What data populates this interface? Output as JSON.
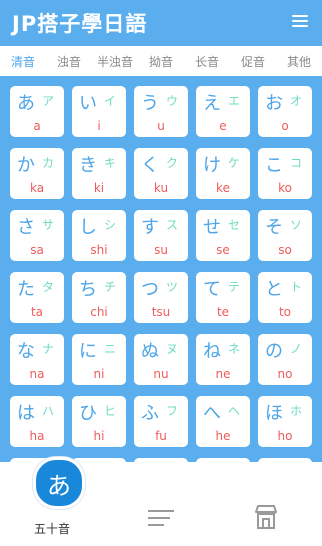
{
  "header": {
    "title": "JP搭子學日語",
    "menu_icon": "hamburger-menu-icon"
  },
  "tabs": [
    {
      "label": "清音",
      "active": true
    },
    {
      "label": "浊音",
      "active": false
    },
    {
      "label": "半浊音",
      "active": false
    },
    {
      "label": "拗音",
      "active": false
    },
    {
      "label": "长音",
      "active": false
    },
    {
      "label": "促音",
      "active": false
    },
    {
      "label": "其他",
      "active": false
    }
  ],
  "kana": [
    [
      {
        "hira": "あ",
        "kata": "ア",
        "roma": "a"
      },
      {
        "hira": "い",
        "kata": "イ",
        "roma": "i"
      },
      {
        "hira": "う",
        "kata": "ウ",
        "roma": "u"
      },
      {
        "hira": "え",
        "kata": "エ",
        "roma": "e"
      },
      {
        "hira": "お",
        "kata": "オ",
        "roma": "o"
      }
    ],
    [
      {
        "hira": "か",
        "kata": "カ",
        "roma": "ka"
      },
      {
        "hira": "き",
        "kata": "キ",
        "roma": "ki"
      },
      {
        "hira": "く",
        "kata": "ク",
        "roma": "ku"
      },
      {
        "hira": "け",
        "kata": "ケ",
        "roma": "ke"
      },
      {
        "hira": "こ",
        "kata": "コ",
        "roma": "ko"
      }
    ],
    [
      {
        "hira": "さ",
        "kata": "サ",
        "roma": "sa"
      },
      {
        "hira": "し",
        "kata": "シ",
        "roma": "shi"
      },
      {
        "hira": "す",
        "kata": "ス",
        "roma": "su"
      },
      {
        "hira": "せ",
        "kata": "セ",
        "roma": "se"
      },
      {
        "hira": "そ",
        "kata": "ソ",
        "roma": "so"
      }
    ],
    [
      {
        "hira": "た",
        "kata": "タ",
        "roma": "ta"
      },
      {
        "hira": "ち",
        "kata": "チ",
        "roma": "chi"
      },
      {
        "hira": "つ",
        "kata": "ツ",
        "roma": "tsu"
      },
      {
        "hira": "て",
        "kata": "テ",
        "roma": "te"
      },
      {
        "hira": "と",
        "kata": "ト",
        "roma": "to"
      }
    ],
    [
      {
        "hira": "な",
        "kata": "ナ",
        "roma": "na"
      },
      {
        "hira": "に",
        "kata": "ニ",
        "roma": "ni"
      },
      {
        "hira": "ぬ",
        "kata": "ヌ",
        "roma": "nu"
      },
      {
        "hira": "ね",
        "kata": "ネ",
        "roma": "ne"
      },
      {
        "hira": "の",
        "kata": "ノ",
        "roma": "no"
      }
    ],
    [
      {
        "hira": "は",
        "kata": "ハ",
        "roma": "ha"
      },
      {
        "hira": "ひ",
        "kata": "ヒ",
        "roma": "hi"
      },
      {
        "hira": "ふ",
        "kata": "フ",
        "roma": "fu"
      },
      {
        "hira": "へ",
        "kata": "ヘ",
        "roma": "he"
      },
      {
        "hira": "ほ",
        "kata": "ホ",
        "roma": "ho"
      }
    ]
  ],
  "bottom_nav": {
    "gojuon": {
      "glyph": "あ",
      "label": "五十音"
    },
    "list_icon": "list-icon",
    "store_icon": "store-icon"
  },
  "colors": {
    "background": "#5aaeee",
    "hiragana": "#4ca5e8",
    "katakana": "#6fdcc0",
    "romaji": "#f05b5b",
    "active_tab": "#4ca5e8",
    "badge": "#1a88da"
  }
}
